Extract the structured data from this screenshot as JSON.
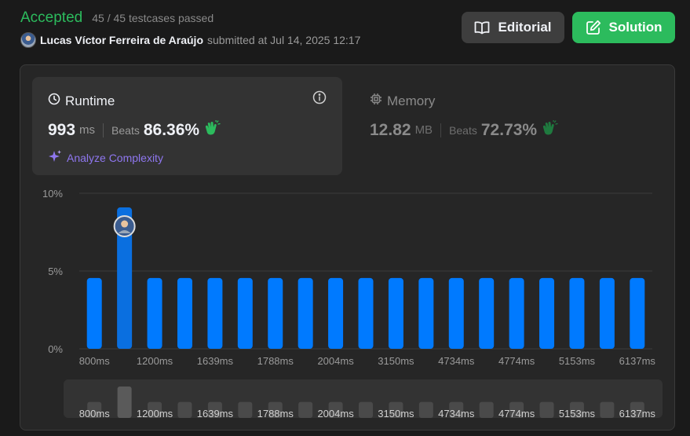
{
  "submission": {
    "status": "Accepted",
    "testcases": "45 / 45 testcases passed",
    "username": "Lucas Víctor Ferreira de Araújo",
    "submitted_text": "submitted at Jul 14, 2025 12:17"
  },
  "buttons": {
    "editorial": "Editorial",
    "solution": "Solution"
  },
  "runtime": {
    "title": "Runtime",
    "value": "993",
    "unit": "ms",
    "beats_label": "Beats",
    "beats_value": "86.36%",
    "analyze_label": "Analyze Complexity"
  },
  "memory": {
    "title": "Memory",
    "value": "12.82",
    "unit": "MB",
    "beats_label": "Beats",
    "beats_value": "72.73%"
  },
  "colors": {
    "accepted": "#2cbb5d",
    "bar": "#007aff",
    "bar_selected": "#0a6fe0",
    "accent_purple": "#8f77f0"
  },
  "chart_data": {
    "type": "bar",
    "categories": [
      "800ms",
      "",
      "1200ms",
      "",
      "1639ms",
      "",
      "1788ms",
      "",
      "2004ms",
      "",
      "3150ms",
      "",
      "4734ms",
      "",
      "4774ms",
      "",
      "5153ms",
      "",
      "6137ms"
    ],
    "values": [
      4.55,
      9.09,
      4.55,
      4.55,
      4.55,
      4.55,
      4.55,
      4.55,
      4.55,
      4.55,
      4.55,
      4.55,
      4.55,
      4.55,
      4.55,
      4.55,
      4.55,
      4.55,
      4.55
    ],
    "highlight_index": 1,
    "ylim": [
      0,
      10
    ],
    "yticks": [
      "0%",
      "5%",
      "10%"
    ],
    "ytick_values": [
      0,
      5,
      10
    ],
    "x_tick_labels": [
      "800ms",
      "1200ms",
      "1639ms",
      "1788ms",
      "2004ms",
      "3150ms",
      "4734ms",
      "4774ms",
      "5153ms",
      "6137ms"
    ],
    "grid": true,
    "legend": "none"
  }
}
